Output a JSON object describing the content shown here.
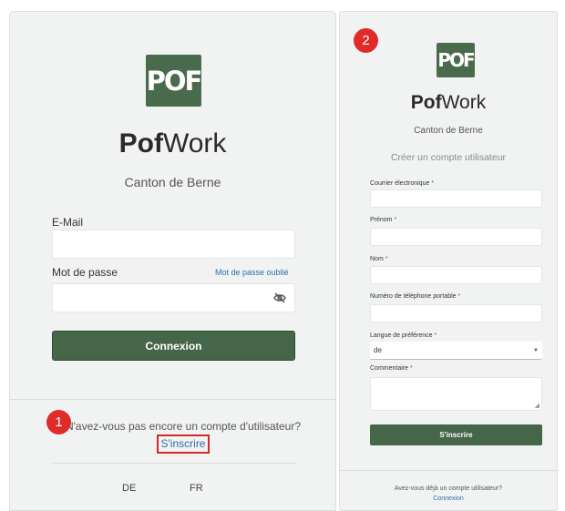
{
  "login": {
    "logo_text": "POF",
    "brand_bold": "Pof",
    "brand_rest": "Work",
    "canton": "Canton de Berne",
    "email_label": "E-Mail",
    "email_value": "",
    "password_label": "Mot de passe",
    "password_value": "",
    "forgot_password": "Mot de passe oublié",
    "login_button": "Connexion",
    "no_account_text": "N'avez-vous pas encore un compte d'utilisateur?",
    "signup_link": "S'inscrire",
    "languages": [
      "DE",
      "FR"
    ]
  },
  "register": {
    "logo_text": "POF",
    "brand_bold": "Pof",
    "brand_rest": "Work",
    "canton": "Canton de Berne",
    "heading": "Créer un compte utilisateur",
    "fields": {
      "email": "Courrier électronique",
      "firstname": "Prénom",
      "lastname": "Nom",
      "phone": "Numéro de téléphone portable",
      "language": "Langue de préférence",
      "comment": "Commentaire"
    },
    "required_marker": "*",
    "language_selected": "de",
    "signup_button": "S'inscrire",
    "have_account_text": "Avez-vous déjà un compte utilisateur?",
    "login_link": "Connexion"
  },
  "annotations": {
    "badge_1": "1",
    "badge_2": "2"
  },
  "colors": {
    "brand_green": "#46664a",
    "link_blue": "#2a6fa8",
    "badge_red": "#e02b2b"
  },
  "icons": {
    "password_toggle": "eye-slash-icon",
    "select_arrow": "caret-down-icon"
  }
}
